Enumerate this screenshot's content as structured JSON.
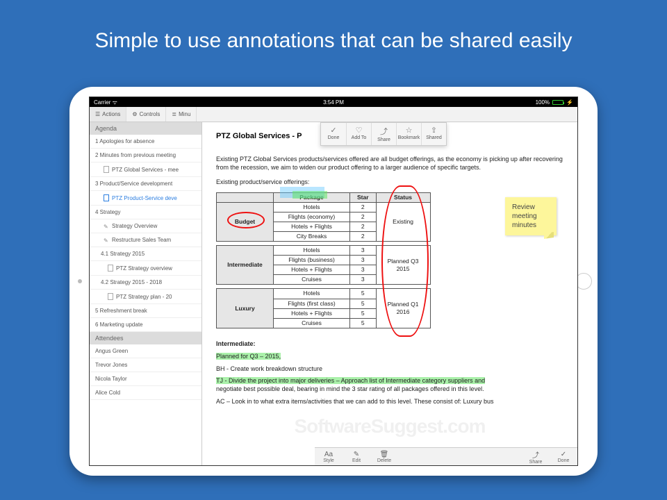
{
  "hero": "Simple to use annotations that can be shared easily",
  "status": {
    "carrier": "Carrier ᯤ",
    "time": "3:54 PM",
    "battery": "100%"
  },
  "toolbar": {
    "actions": "Actions",
    "controls": "Controls",
    "minutes": "Minu"
  },
  "popup": {
    "done": "Done",
    "addto": "Add To",
    "share": "Share",
    "bookmark": "Bookmark",
    "shared": "Shared"
  },
  "sidebar": {
    "agenda_head": "Agenda",
    "items": [
      "1 Apologies for absence",
      "2 Minutes from previous meeting",
      "PTZ Global Services - mee",
      "3 Product/Service development",
      "PTZ Product-Service deve",
      "4 Strategy",
      "Strategy Overview",
      "Restructure Sales Team",
      "4.1 Strategy 2015",
      "PTZ Strategy overview",
      "4.2 Strategy 2015 - 2018",
      "PTZ Strategy plan - 20",
      "5 Refreshment break",
      "6 Marketing update"
    ],
    "attendees_head": "Attendees",
    "attendees": [
      "Angus Green",
      "Trevor Jones",
      "Nicola Taylor",
      "Alice Cold"
    ]
  },
  "doc": {
    "title": "PTZ Global Services - P",
    "intro": "Existing PTZ Global Services products/services offered are all budget offerings, as the economy is picking up after recovering from the recession, we aim to widen our product offering to a larger audience of specific targets.",
    "offerings_label": "Existing product/service offerings:",
    "table": {
      "headers": [
        "",
        "Package",
        "Star",
        "Status"
      ],
      "groups": [
        {
          "cat": "Budget",
          "status": "Existing",
          "rows": [
            [
              "Hotels",
              "2"
            ],
            [
              "Flights (economy)",
              "2"
            ],
            [
              "Hotels + Flights",
              "2"
            ],
            [
              "City Breaks",
              "2"
            ]
          ]
        },
        {
          "cat": "Intermediate",
          "status": "Planned Q3 2015",
          "rows": [
            [
              "Hotels",
              "3"
            ],
            [
              "Flights (business)",
              "3"
            ],
            [
              "Hotels + Flights",
              "3"
            ],
            [
              "Cruises",
              "3"
            ]
          ]
        },
        {
          "cat": "Luxury",
          "status": "Planned Q1 2016",
          "rows": [
            [
              "Hotels",
              "5"
            ],
            [
              "Flights (first class)",
              "5"
            ],
            [
              "Hotels + Flights",
              "5"
            ],
            [
              "Cruises",
              "5"
            ]
          ]
        }
      ]
    },
    "sticky": "Review meeting minutes",
    "section_head": "Intermediate:",
    "planned_line": "Planned for Q3 – 2015,",
    "bh_line": "BH - Create work breakdown structure",
    "tj_line": "TJ - Divide the project into major deliveries – Approach list of Intermediate category suppliers and",
    "tj_line2": "negotiate best possible deal, bearing in mind the 3 star rating of all packages offered in this level.",
    "ac_line": "AC – Look in to what extra items/activities that we can add to this level. These consist of: Luxury bus"
  },
  "bottom": {
    "style": "Style",
    "edit": "Edit",
    "delete": "Delete",
    "share": "Share",
    "done": "Done"
  },
  "watermark": "SoftwareSuggest.com"
}
